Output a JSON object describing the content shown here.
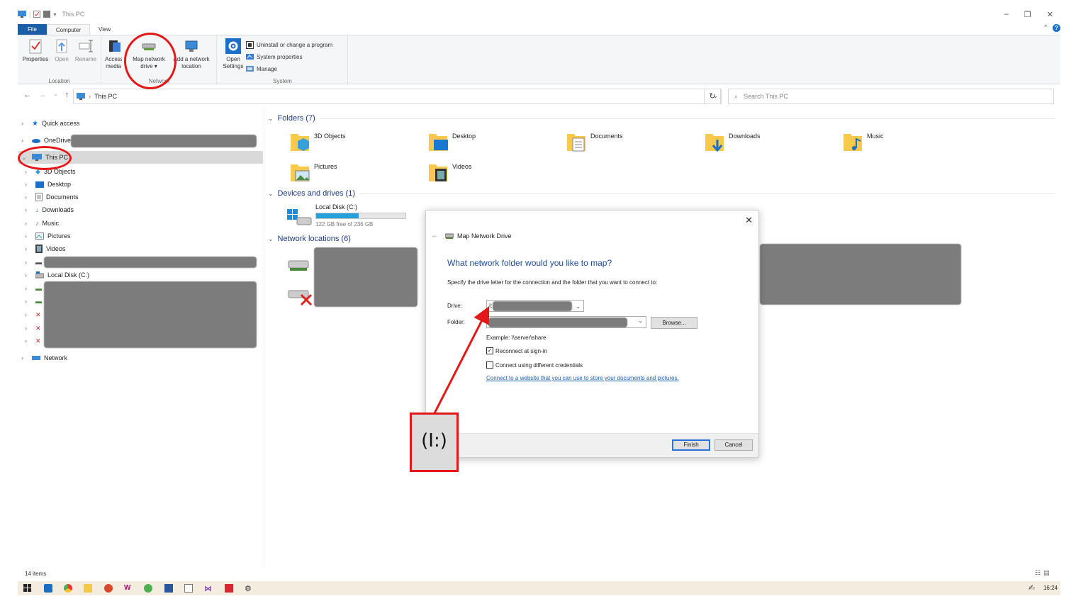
{
  "window": {
    "title": "This PC",
    "controls": [
      "–",
      "❐",
      "✕"
    ]
  },
  "ribbon": {
    "tabs": [
      "File",
      "Computer",
      "View"
    ],
    "location_group": {
      "label": "Location",
      "buttons": [
        "Properties",
        "Open",
        "Rename"
      ]
    },
    "network_group": {
      "label": "Network",
      "access_media": "Access media",
      "map_network_drive": [
        "Map network",
        "drive ▾"
      ],
      "add_network_location": [
        "Add a network",
        "location"
      ]
    },
    "system_group": {
      "label": "System",
      "open_settings": [
        "Open",
        "Settings"
      ],
      "items": [
        "Uninstall or change a program",
        "System properties",
        "Manage"
      ]
    }
  },
  "address": {
    "path": "This PC",
    "search_placeholder": "Search This PC"
  },
  "nav": {
    "quick_access": "Quick access",
    "onedrive": "OneDrive -",
    "this_pc": "This PC",
    "children": [
      "3D Objects",
      "Desktop",
      "Documents",
      "Downloads",
      "Music",
      "Pictures",
      "Videos"
    ],
    "local_disk": "Local Disk (C:)",
    "network": "Network"
  },
  "content": {
    "folders_header": "Folders (7)",
    "folders": [
      "3D Objects",
      "Desktop",
      "Documents",
      "Downloads",
      "Music",
      "Pictures",
      "Videos"
    ],
    "devices_header": "Devices and drives (1)",
    "drive": {
      "name": "Local Disk (C:)",
      "free_text": "122 GB free of 236 GB",
      "used_fraction": 0.48
    },
    "network_header": "Network locations (6)"
  },
  "dialog": {
    "title": "Map Network Drive",
    "heading": "What network folder would you like to map?",
    "subtext": "Specify the drive letter for the connection and the folder that you want to connect to:",
    "drive_label": "Drive:",
    "drive_value": "I:",
    "folder_label": "Folder:",
    "browse": "Browse...",
    "example": "Example: \\\\server\\share",
    "reconnect": "Reconnect at sign-in",
    "reconnect_checked": true,
    "different_credentials": "Connect using different credentials",
    "different_credentials_checked": false,
    "link": "Connect to a website that you can use to store your documents and pictures",
    "link_suffix": ".",
    "finish": "Finish",
    "cancel": "Cancel"
  },
  "annotation": {
    "zoom_text": "(I:)",
    "color": "#e31818"
  },
  "status": {
    "items": "14 items"
  },
  "taskbar": {
    "time": "16:24"
  },
  "colors": {
    "accent": "#1a5ea8",
    "folder_yellow": "#f8c94b",
    "link": "#1a5fb4",
    "drive_fill": "#26a0da"
  }
}
